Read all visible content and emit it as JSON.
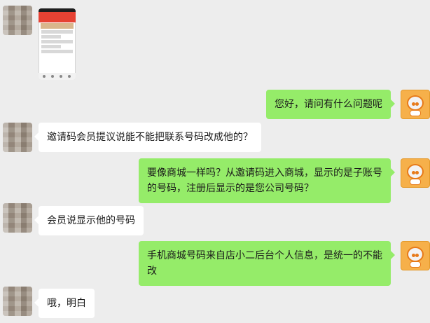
{
  "chat": {
    "messages": [
      {
        "type": "image",
        "side": "left",
        "icon": "screenshot-thumbnail"
      },
      {
        "type": "text",
        "side": "right",
        "text": "您好，请问有什么问题呢"
      },
      {
        "type": "text",
        "side": "left",
        "text": "邀请码会员提议说能不能把联系号码改成他的？"
      },
      {
        "type": "text",
        "side": "right",
        "text": "要像商城一样吗？从邀请码进入商城，显示的是子账号的号码，注册后显示的是您公司号码？"
      },
      {
        "type": "text",
        "side": "left",
        "text": "会员说显示他的号码"
      },
      {
        "type": "text",
        "side": "right",
        "text": "手机商城号码来自店小二后台个人信息，是统一的不能改"
      },
      {
        "type": "text",
        "side": "left",
        "text": "哦，明白"
      }
    ]
  },
  "colors": {
    "background": "#ededed",
    "right_bubble": "#95ec69",
    "left_bubble": "#ffffff",
    "agent_avatar": "#f6b04a"
  },
  "icons": {
    "customer_avatar": "blurred-avatar",
    "agent_avatar": "robot-avatar-icon"
  }
}
